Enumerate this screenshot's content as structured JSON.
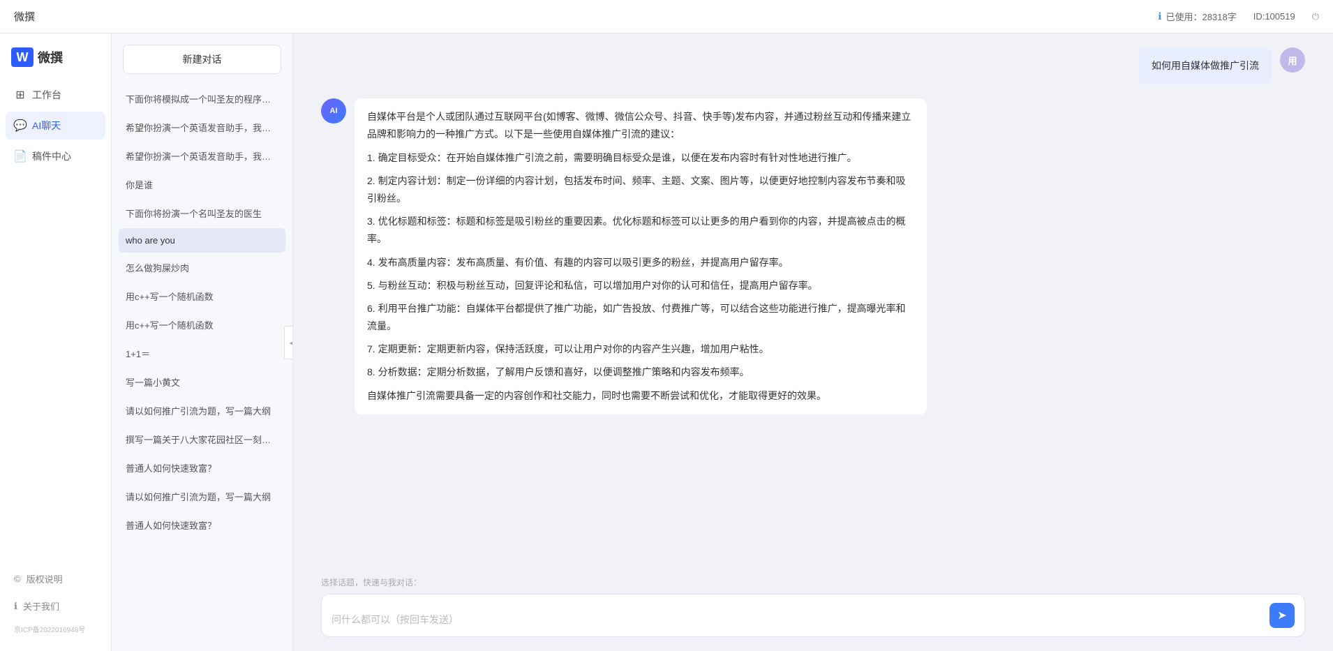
{
  "topbar": {
    "title": "微撰",
    "usage_label": "已使用：28318字",
    "id_label": "ID:100519",
    "logout_icon": "⏻"
  },
  "sidebar": {
    "logo_text": "微撰",
    "nav_items": [
      {
        "id": "workbench",
        "label": "工作台",
        "icon": "⊞"
      },
      {
        "id": "ai-chat",
        "label": "AI聊天",
        "icon": "💬",
        "active": true
      },
      {
        "id": "drafts",
        "label": "稿件中心",
        "icon": "📄"
      }
    ],
    "bottom_items": [
      {
        "id": "copyright",
        "label": "版权说明",
        "icon": "©"
      },
      {
        "id": "about",
        "label": "关于我们",
        "icon": "ℹ"
      }
    ],
    "icp": "京ICP备2022016948号"
  },
  "chat_history": {
    "new_chat_label": "新建对话",
    "items": [
      {
        "id": 1,
        "text": "下面你将模拟成一个叫圣友的程序员，我说...",
        "active": false
      },
      {
        "id": 2,
        "text": "希望你扮演一个英语发音助手，我提供给你...",
        "active": false
      },
      {
        "id": 3,
        "text": "希望你扮演一个英语发音助手，我提供给你...",
        "active": false
      },
      {
        "id": 4,
        "text": "你是谁",
        "active": false
      },
      {
        "id": 5,
        "text": "下面你将扮演一个名叫圣友的医生",
        "active": false
      },
      {
        "id": 6,
        "text": "who are you",
        "active": true
      },
      {
        "id": 7,
        "text": "怎么做狗屎炒肉",
        "active": false
      },
      {
        "id": 8,
        "text": "用c++写一个随机函数",
        "active": false
      },
      {
        "id": 9,
        "text": "用c++写一个随机函数",
        "active": false
      },
      {
        "id": 10,
        "text": "1+1＝",
        "active": false
      },
      {
        "id": 11,
        "text": "写一篇小黄文",
        "active": false
      },
      {
        "id": 12,
        "text": "请以如何推广引流为题，写一篇大纲",
        "active": false
      },
      {
        "id": 13,
        "text": "撰写一篇关于八大家花园社区一刻钟便民生...",
        "active": false
      },
      {
        "id": 14,
        "text": "普通人如何快速致富？",
        "active": false
      },
      {
        "id": 15,
        "text": "请以如何推广引流为题，写一篇大纲",
        "active": false
      },
      {
        "id": 16,
        "text": "普通人如何快速致富？",
        "active": false
      }
    ]
  },
  "chat": {
    "messages": [
      {
        "id": 1,
        "role": "user",
        "avatar_text": "用",
        "text": "如何用自媒体做推广引流"
      },
      {
        "id": 2,
        "role": "ai",
        "avatar_text": "AI",
        "paragraphs": [
          "自媒体平台是个人或团队通过互联网平台(如博客、微博、微信公众号、抖音、快手等)发布内容，并通过粉丝互动和传播来建立品牌和影响力的一种推广方式。以下是一些使用自媒体推广引流的建议：",
          "1. 确定目标受众：在开始自媒体推广引流之前，需要明确目标受众是谁，以便在发布内容时有针对性地进行推广。",
          "2. 制定内容计划：制定一份详细的内容计划，包括发布时间、频率、主题、文案、图片等，以便更好地控制内容发布节奏和吸引粉丝。",
          "3. 优化标题和标签：标题和标签是吸引粉丝的重要因素。优化标题和标签可以让更多的用户看到你的内容，并提高被点击的概率。",
          "4. 发布高质量内容：发布高质量、有价值、有趣的内容可以吸引更多的粉丝，并提高用户留存率。",
          "5. 与粉丝互动：积极与粉丝互动，回复评论和私信，可以增加用户对你的认可和信任，提高用户留存率。",
          "6. 利用平台推广功能：自媒体平台都提供了推广功能，如广告投放、付费推广等，可以结合这些功能进行推广，提高曝光率和流量。",
          "7. 定期更新：定期更新内容，保持活跃度，可以让用户对你的内容产生兴趣，增加用户粘性。",
          "8. 分析数据：定期分析数据，了解用户反馈和喜好，以便调整推广策略和内容发布频率。",
          "自媒体推广引流需要具备一定的内容创作和社交能力，同时也需要不断尝试和优化，才能取得更好的效果。"
        ]
      }
    ],
    "quick_topics_label": "选择话题，快速与我对话：",
    "input_placeholder": "问什么都可以（按回车发送）",
    "send_icon": "➤"
  }
}
